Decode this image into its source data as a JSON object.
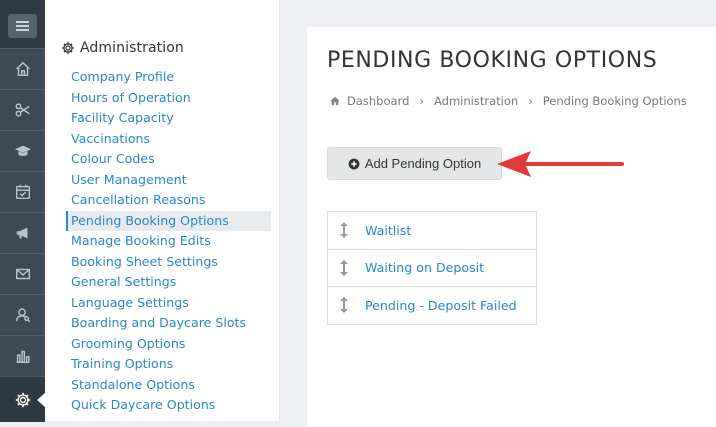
{
  "rail": {
    "items": [
      {
        "icon": "home-icon"
      },
      {
        "icon": "scissors-icon"
      },
      {
        "icon": "graduation-cap-icon"
      },
      {
        "icon": "calendar-check-icon"
      },
      {
        "icon": "megaphone-icon"
      },
      {
        "icon": "envelope-icon"
      },
      {
        "icon": "user-search-icon"
      },
      {
        "icon": "bar-chart-icon"
      },
      {
        "icon": "gear-icon",
        "active": true
      }
    ]
  },
  "subnav": {
    "title": "Administration",
    "items": [
      "Company Profile",
      "Hours of Operation",
      "Facility Capacity",
      "Vaccinations",
      "Colour Codes",
      "User Management",
      "Cancellation Reasons",
      "Pending Booking Options",
      "Manage Booking Edits",
      "Booking Sheet Settings",
      "General Settings",
      "Language Settings",
      "Boarding and Daycare Slots",
      "Grooming Options",
      "Training Options",
      "Standalone Options",
      "Quick Daycare Options"
    ],
    "active_item": "Pending Booking Options"
  },
  "main": {
    "title": "PENDING BOOKING OPTIONS",
    "breadcrumb": [
      "Dashboard",
      "Administration",
      "Pending Booking Options"
    ],
    "add_button_label": "Add Pending Option",
    "options": [
      "Waitlist",
      "Waiting on Deposit",
      "Pending - Deposit Failed"
    ]
  },
  "colors": {
    "rail": "#3b4a56",
    "link": "#2a86c8",
    "annotation_arrow": "#e03a3a"
  }
}
